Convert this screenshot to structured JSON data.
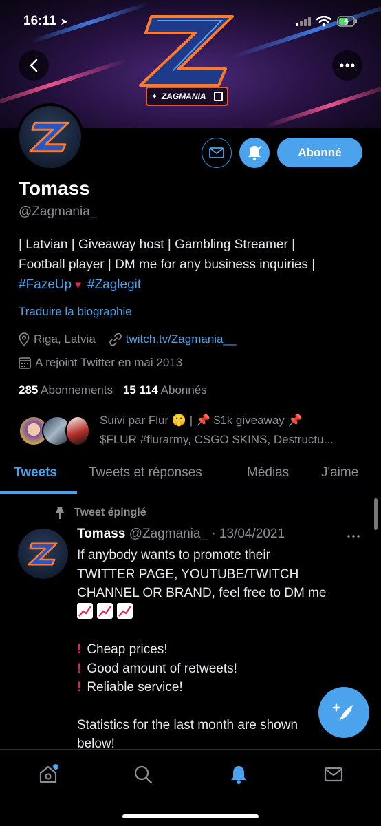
{
  "status_bar": {
    "time": "16:11"
  },
  "banner": {
    "tag_text": "ZAGMANIA_"
  },
  "profile": {
    "name": "Tomass",
    "handle": "@Zagmania_",
    "bio_line1": "| Latvian | Giveaway host | Gambling Streamer |",
    "bio_line2": "Football player | DM me for any business inquiries |",
    "bio_hashtag1": "#FazeUp",
    "bio_hashtag2": "#Zaglegit",
    "translate_label": "Traduire la biographie",
    "location": "Riga, Latvia",
    "website": "twitch.tv/Zagmania__",
    "joined": "A rejoint Twitter en mai 2013",
    "following_count": "285",
    "following_label": "Abonnements",
    "followers_count": "15 114",
    "followers_label": "Abonnés",
    "follow_button_label": "Abonné",
    "followed_by_line1": "Suivi par Flur 🤫 | 📌 $1k giveaway 📌",
    "followed_by_line2": "$FLUR #flurarmy, CSGO SKINS, Destructu..."
  },
  "tabs": [
    {
      "label": "Tweets",
      "active": true
    },
    {
      "label": "Tweets et réponses",
      "active": false
    },
    {
      "label": "Médias",
      "active": false
    },
    {
      "label": "J'aime",
      "active": false
    }
  ],
  "tweet": {
    "pinned_label": "Tweet épinglé",
    "author_name": "Tomass",
    "author_handle": "@Zagmania_",
    "separator": "·",
    "date": "13/04/2021",
    "text_line1": "If anybody wants to promote their",
    "text_line2": "TWITTER PAGE, YOUTUBE/TWITCH",
    "text_line3": "CHANNEL OR BRAND, feel free to DM me",
    "bullet1": "Cheap prices!",
    "bullet2": "Good amount of retweets!",
    "bullet3": "Reliable service!",
    "stats_line1": "Statistics for the last month are shown",
    "stats_line2": "below!"
  },
  "colors": {
    "accent": "#4aa3ec",
    "muted": "#8b8f94",
    "background": "#000000",
    "alert": "#e0245e"
  },
  "icons": [
    "back-icon",
    "more-icon",
    "mail-icon",
    "bell-icon",
    "location-icon",
    "link-icon",
    "calendar-icon",
    "pin-icon",
    "compose-icon",
    "home-icon",
    "search-icon",
    "notifications-icon",
    "messages-icon"
  ]
}
